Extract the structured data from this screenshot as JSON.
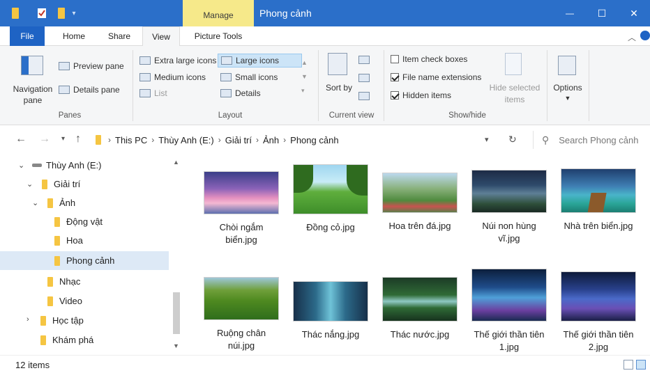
{
  "title_bar": {
    "contextual_tab": "Manage",
    "window_title": "Phong cảnh",
    "minimize": "—",
    "maximize": "☐",
    "close": "✕"
  },
  "ribbon_tabs": [
    "File",
    "Home",
    "Share",
    "View",
    "Picture Tools"
  ],
  "ribbon": {
    "panes": {
      "navigation_pane": "Navigation pane",
      "preview_pane": "Preview pane",
      "details_pane": "Details pane",
      "label": "Panes"
    },
    "layout": {
      "extra_large": "Extra large icons",
      "large": "Large icons",
      "medium": "Medium icons",
      "small": "Small icons",
      "list": "List",
      "details": "Details",
      "label": "Layout"
    },
    "current_view": {
      "sort_by": "Sort by",
      "label": "Current view"
    },
    "show_hide": {
      "item_check_boxes": "Item check boxes",
      "file_name_extensions": "File name extensions",
      "hidden_items": "Hidden items",
      "hide_selected": "Hide selected items",
      "label": "Show/hide"
    },
    "options": "Options"
  },
  "address": {
    "breadcrumbs": [
      "This PC",
      "Thùy Anh (E:)",
      "Giải trí",
      "Ảnh",
      "Phong cảnh"
    ],
    "search_placeholder": "Search Phong cảnh"
  },
  "nav_tree": [
    {
      "label": "Thùy Anh (E:)"
    },
    {
      "label": "Giải trí"
    },
    {
      "label": "Ảnh"
    },
    {
      "label": "Động vật"
    },
    {
      "label": "Hoa"
    },
    {
      "label": "Phong cảnh"
    },
    {
      "label": "Nhạc"
    },
    {
      "label": "Video"
    },
    {
      "label": "Học tập"
    },
    {
      "label": "Khám phá"
    }
  ],
  "files": [
    {
      "name": "Chòi ngắm biển.jpg"
    },
    {
      "name": "Đồng cỏ.jpg"
    },
    {
      "name": "Hoa trên đá.jpg"
    },
    {
      "name": "Núi non hùng vĩ.jpg"
    },
    {
      "name": "Nhà trên biển.jpg"
    },
    {
      "name": "Ruộng chân núi.jpg"
    },
    {
      "name": "Thác nắng.jpg"
    },
    {
      "name": "Thác nước.jpg"
    },
    {
      "name": "Thế giới thần tiên 1.jpg"
    },
    {
      "name": "Thế giới thần tiên 2.jpg"
    }
  ],
  "status": {
    "item_count": "12 items"
  },
  "colors": {
    "title_bar": "#2b6fc9",
    "manage_tab": "#f6e98a",
    "selected_nav": "#dde9f6"
  }
}
